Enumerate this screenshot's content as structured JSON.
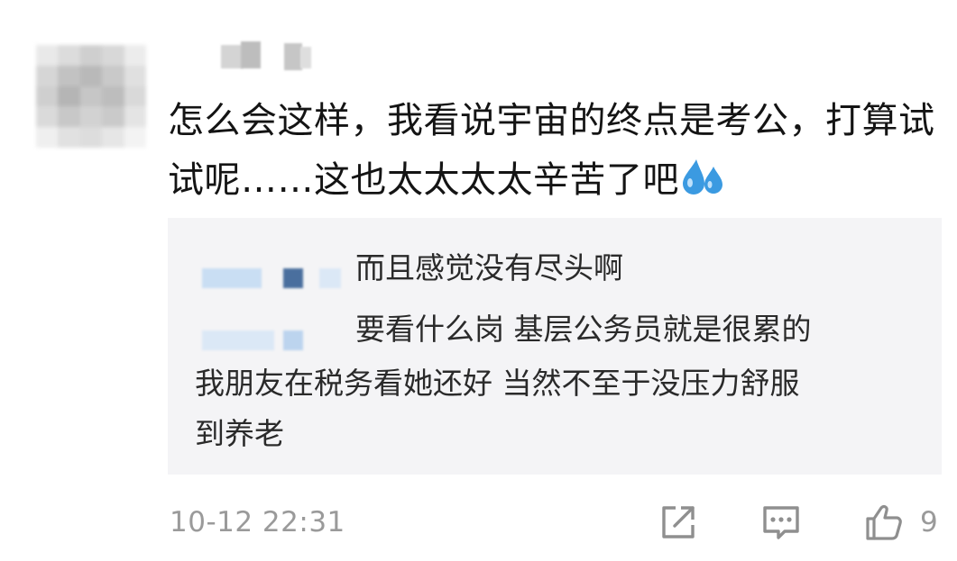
{
  "comment": {
    "text": "怎么会这样，我看说宇宙的终点是考公，打算试试呢……这也太太太太辛苦了吧",
    "emoji": "sweat-drops-emoji"
  },
  "quote": {
    "line1": "而且感觉没有尽头啊",
    "line2": "要看什么岗 基层公务员就是很累的",
    "line3": "我朋友在税务看她还好 当然不至于没压力舒服",
    "line4": "到养老"
  },
  "footer": {
    "timestamp": "10-12 22:31",
    "like_count": "9"
  },
  "icons": {
    "share": "share-icon",
    "reply": "comment-icon",
    "like": "thumbs-up-icon"
  },
  "colors": {
    "text": "#141414",
    "meta": "#9a9a9a",
    "quote_bg": "#f4f4f6",
    "emoji": "#3b9ae1"
  }
}
